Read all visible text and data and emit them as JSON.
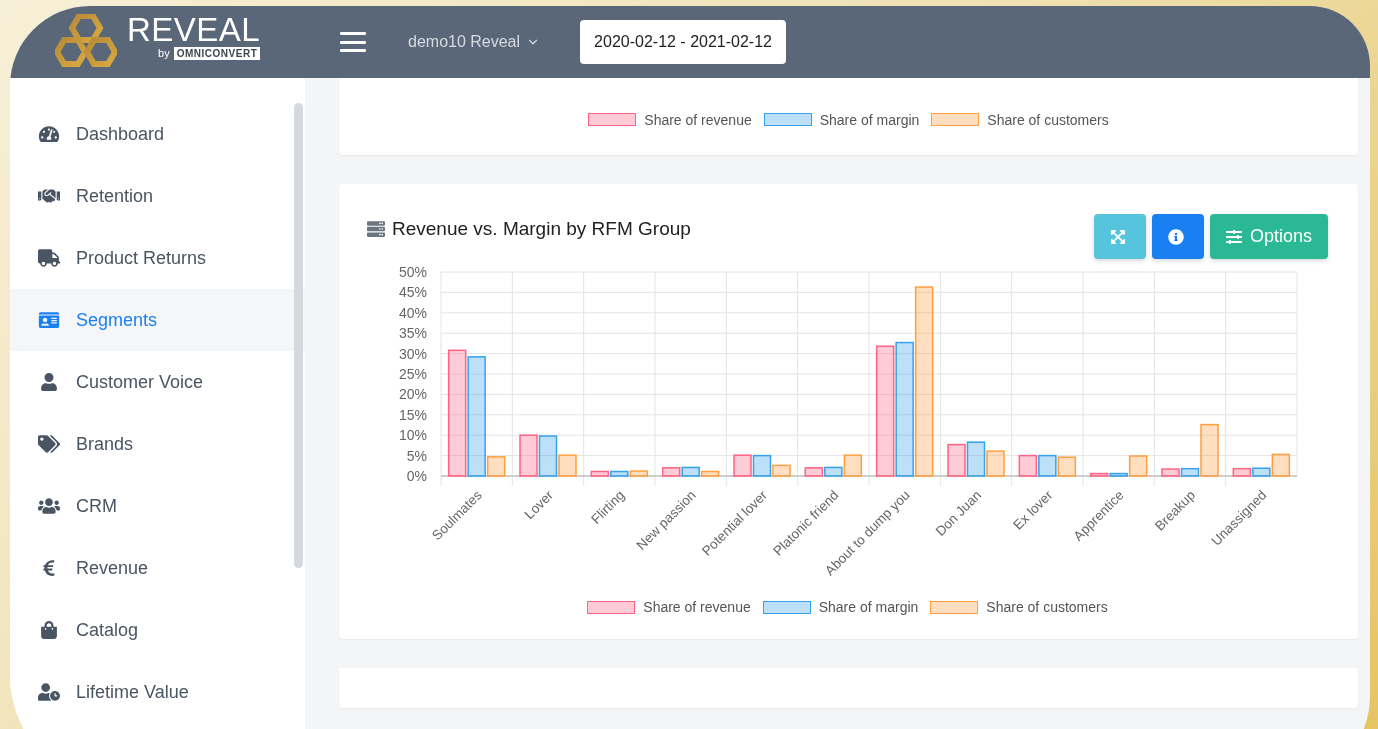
{
  "header": {
    "brand": "REVEAL",
    "brand_by": "by",
    "brand_company": "OMNICONVERT",
    "account": "demo10 Reveal",
    "date_range": "2020-02-12 - 2021-02-12"
  },
  "sidebar": {
    "items": [
      {
        "label": "Dashboard",
        "selected": false
      },
      {
        "label": "Retention",
        "selected": false
      },
      {
        "label": "Product Returns",
        "selected": false
      },
      {
        "label": "Segments",
        "selected": true
      },
      {
        "label": "Customer Voice",
        "selected": false
      },
      {
        "label": "Brands",
        "selected": false
      },
      {
        "label": "CRM",
        "selected": false
      },
      {
        "label": "Revenue",
        "selected": false
      },
      {
        "label": "Catalog",
        "selected": false
      },
      {
        "label": "Lifetime Value",
        "selected": false
      }
    ]
  },
  "top_card": {
    "legend": [
      {
        "name": "Share of revenue",
        "color": "#ff6384"
      },
      {
        "name": "Share of margin",
        "color": "#36a2eb"
      },
      {
        "name": "Share of customers",
        "color": "#ff9f40"
      }
    ]
  },
  "chart_card": {
    "title": "Revenue vs. Margin by RFM Group",
    "buttons": [
      {
        "kind": "expand"
      },
      {
        "kind": "info"
      },
      {
        "kind": "options",
        "label": "Options"
      }
    ],
    "chart_data": {
      "type": "bar",
      "categories": [
        "Soulmates",
        "Lover",
        "Flirting",
        "New passion",
        "Potential lover",
        "Platonic friend",
        "About to dump you",
        "Don Juan",
        "Ex lover",
        "Apprentice",
        "Breakup",
        "Unassigned"
      ],
      "series": [
        {
          "name": "Share of revenue",
          "color": "#ff6384",
          "values": [
            30.8,
            10,
            1.1,
            2,
            5.1,
            2,
            31.8,
            7.7,
            5,
            0.6,
            1.7,
            1.8
          ]
        },
        {
          "name": "Share of margin",
          "color": "#36a2eb",
          "values": [
            29.2,
            9.8,
            1.1,
            2.1,
            5,
            2.1,
            32.7,
            8.3,
            5,
            0.6,
            1.8,
            1.9
          ]
        },
        {
          "name": "Share of customers",
          "color": "#ff9f40",
          "values": [
            4.7,
            5.1,
            1.2,
            1.1,
            2.6,
            5.1,
            46.3,
            6.1,
            4.6,
            4.9,
            12.6,
            5.3
          ]
        }
      ],
      "ylim": [
        0,
        50
      ],
      "grid": true,
      "yticks": [
        {
          "value": 0,
          "label": "0%"
        },
        {
          "value": 5,
          "label": "5%"
        },
        {
          "value": 10,
          "label": "10%"
        },
        {
          "value": 15,
          "label": "15%"
        },
        {
          "value": 20,
          "label": "20%"
        },
        {
          "value": 25,
          "label": "25%"
        },
        {
          "value": 30,
          "label": "30%"
        },
        {
          "value": 35,
          "label": "35%"
        },
        {
          "value": 40,
          "label": "40%"
        },
        {
          "value": 45,
          "label": "45%"
        },
        {
          "value": 50,
          "label": "50%"
        }
      ]
    }
  }
}
